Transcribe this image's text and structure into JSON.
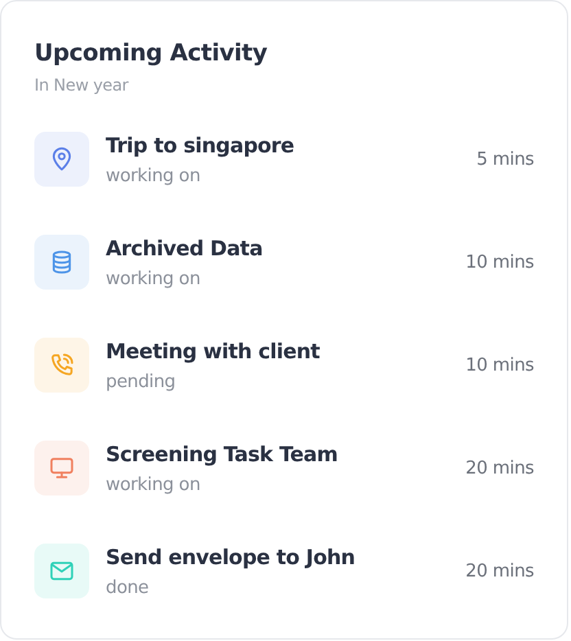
{
  "card": {
    "title": "Upcoming Activity",
    "subtitle": "In New year"
  },
  "activities": [
    {
      "title": "Trip to singapore",
      "status": "working on",
      "time": "5 mins",
      "kind": "pin",
      "color": "#5b7fe8"
    },
    {
      "title": "Archived Data",
      "status": "working on",
      "time": "10 mins",
      "kind": "database",
      "color": "#4d94e8"
    },
    {
      "title": "Meeting with client",
      "status": "pending",
      "time": "10 mins",
      "kind": "phone",
      "color": "#f5a623"
    },
    {
      "title": "Screening Task Team",
      "status": "working on",
      "time": "20 mins",
      "kind": "monitor",
      "color": "#f0805f"
    },
    {
      "title": "Send envelope to John",
      "status": "done",
      "time": "20 mins",
      "kind": "mail",
      "color": "#2fd1b8"
    }
  ]
}
